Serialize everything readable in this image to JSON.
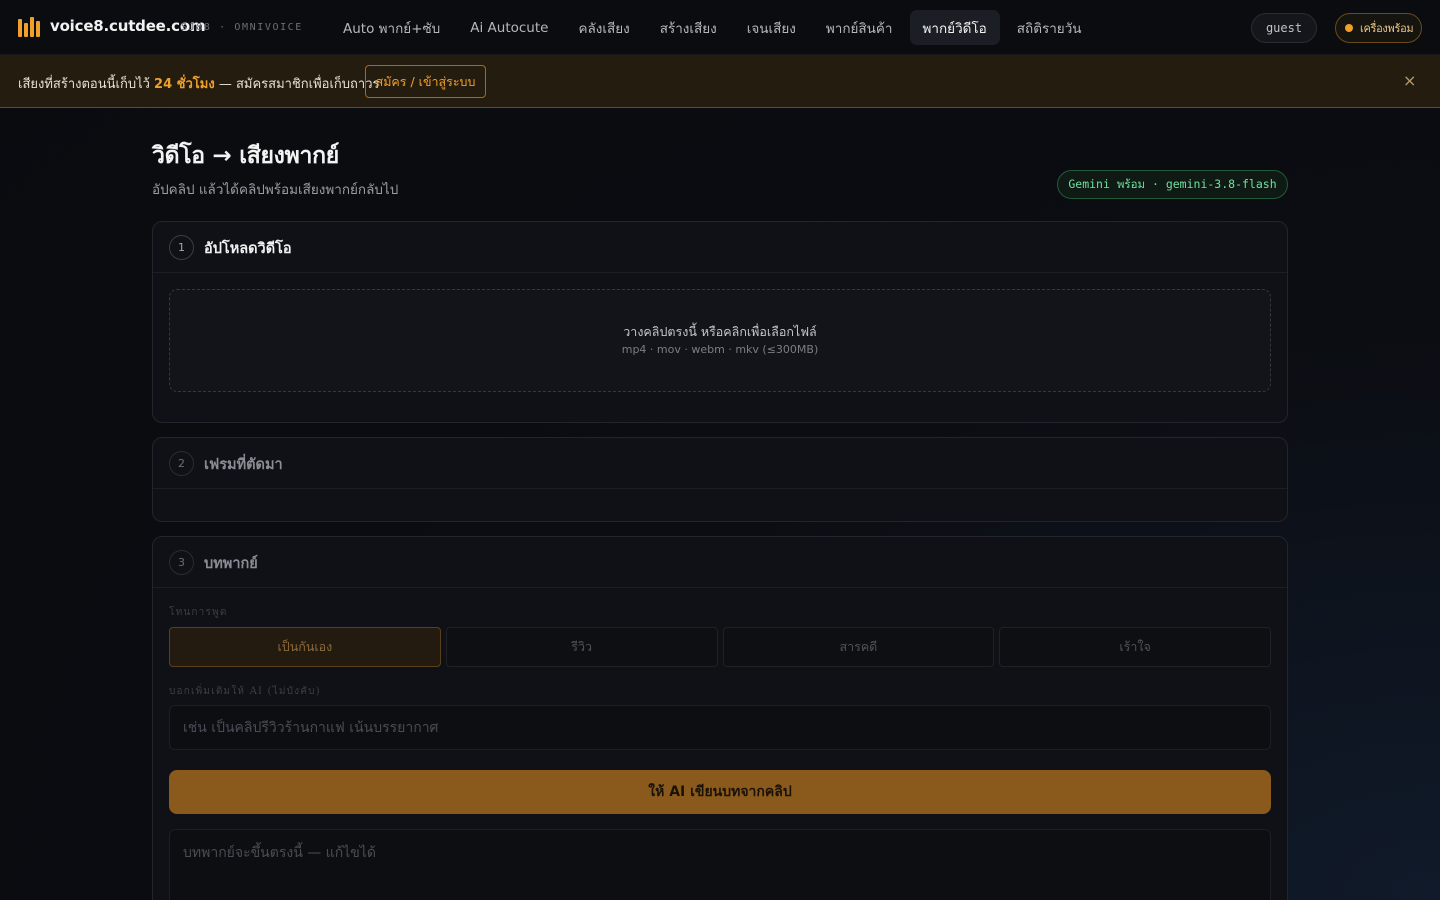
{
  "header": {
    "brand": "voice8.cutdee.com",
    "brand_sub": "SJ88 · OMNIVOICE",
    "nav": [
      {
        "label": "Auto พากย์+ซับ"
      },
      {
        "label": "Ai Autocute"
      },
      {
        "label": "คลังเสียง"
      },
      {
        "label": "สร้างเสียง"
      },
      {
        "label": "เจนเสียง"
      },
      {
        "label": "พากย์สินค้า"
      },
      {
        "label": "พากย์วิดีโอ",
        "active": true
      },
      {
        "label": "สถิติรายวัน"
      }
    ],
    "user": "guest",
    "status": "เครื่องพร้อม",
    "status_color": "#f0a02a"
  },
  "banner": {
    "text_before": "เสียงที่สร้างตอนนี้เก็บไว้ ",
    "highlight": "24 ชั่วโมง",
    "text_after": " — สมัครสมาชิกเพื่อเก็บถาวร",
    "button": "สมัคร / เข้าสู่ระบบ",
    "close": "×"
  },
  "page": {
    "title": "วิดีโอ → เสียงพากย์",
    "subtitle": "อัปคลิป แล้วได้คลิปพร้อมเสียงพากย์กลับไป",
    "model_badge": "Gemini พร้อม · gemini-3.8-flash"
  },
  "step1": {
    "num": "1",
    "title": "อัปโหลดวิดีโอ",
    "drop_main": "วางคลิปตรงนี้ หรือคลิกเพื่อเลือกไฟล์",
    "drop_sub": "mp4 · mov · webm · mkv (≤300MB)"
  },
  "step2": {
    "num": "2",
    "title": "เฟรมที่ตัดมา"
  },
  "step3": {
    "num": "3",
    "title": "บทพากย์",
    "tone_label": "โทนการพูด",
    "tones": [
      "เป็นกันเอง",
      "รีวิว",
      "สารคดี",
      "เร้าใจ"
    ],
    "active_tone": "เป็นกันเอง",
    "hint_label": "บอกเพิ่มเติมให้ AI (ไม่บังคับ)",
    "hint_placeholder": "เช่น เป็นคลิปรีวิวร้านกาแฟ เน้นบรรยากาศ",
    "ai_button": "ให้ AI เขียนบทจากคลิป",
    "script_placeholder": "บทพากย์จะขึ้นตรงนี้ — แก้ไขได้"
  },
  "colors": {
    "accent": "#f0a02a",
    "ready_green": "#6fe0a0",
    "background": "#0a0b0f"
  }
}
